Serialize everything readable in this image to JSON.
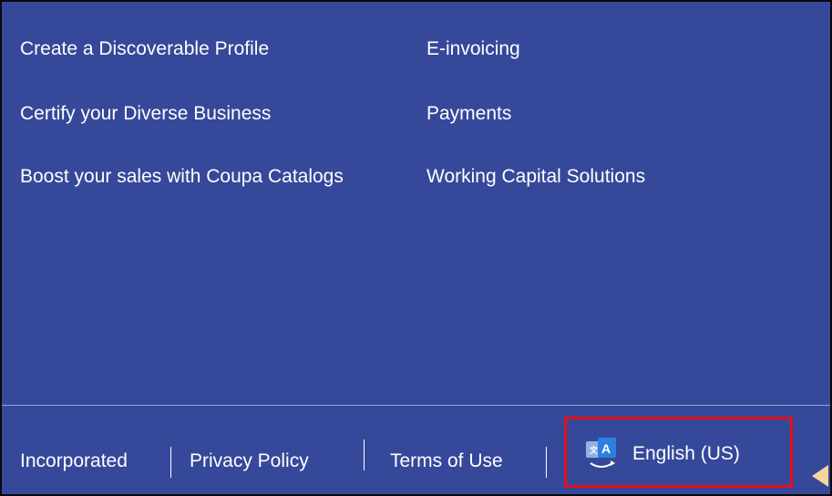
{
  "links": {
    "left": [
      "Create a Discoverable Profile",
      "Certify your Diverse Business",
      "Boost your sales with Coupa Catalogs"
    ],
    "right": [
      "E-invoicing",
      "Payments",
      "Working Capital Solutions"
    ]
  },
  "footer": {
    "incorporated": "Incorporated",
    "privacy": "Privacy Policy",
    "terms": "Terms of Use",
    "language": "English (US)",
    "language_icon": "translate-icon"
  },
  "colors": {
    "background": "#36489a",
    "highlight_border": "#e3101a",
    "divider": "#9aa3c9"
  }
}
